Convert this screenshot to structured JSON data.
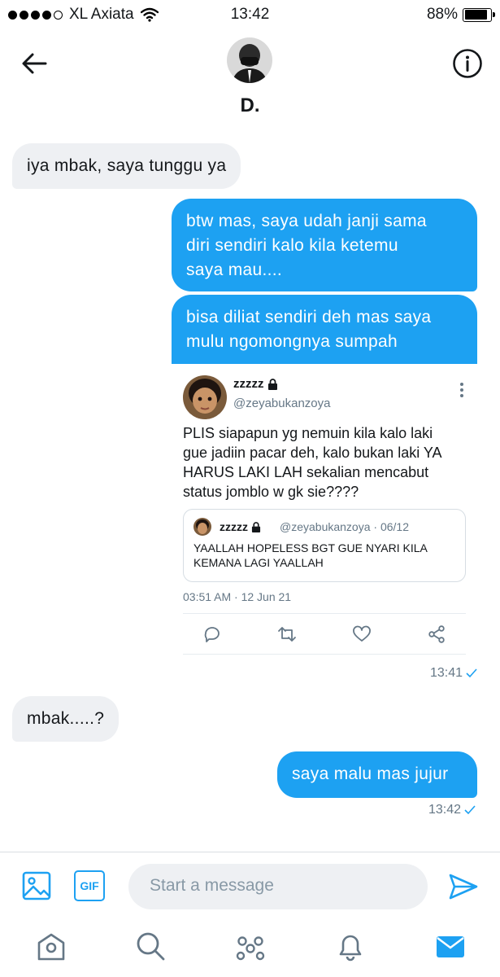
{
  "status_bar": {
    "carrier": "XL Axiata",
    "time": "13:42",
    "battery": "88%",
    "battery_level": 0.88
  },
  "conversation": {
    "name": "D.",
    "back_icon": "arrow-left-icon",
    "info_icon": "info-icon"
  },
  "messages": [
    {
      "direction": "in",
      "text": "iya mbak, saya tunggu ya"
    },
    {
      "direction": "out",
      "lines": [
        "btw mas, saya udah janji sama",
        "diri sendiri kalo kila ketemu",
        "saya mau...."
      ]
    },
    {
      "direction": "out",
      "lines": [
        "bisa diliat sendiri deh mas saya",
        "mulu ngomongnya sumpah"
      ]
    },
    {
      "direction": "in",
      "text": "mbak.....?"
    },
    {
      "direction": "out",
      "text": "saya malu mas jujur"
    }
  ],
  "shared_tweet": {
    "name": "zzzzz",
    "handle": "@zeyabukanzoya",
    "lines": [
      "PLIS siapapun yg nemuin kila kalo laki",
      "gue jadiin pacar deh, kalo bukan laki YA",
      "HARUS LAKI LAH sekalian mencabut",
      "status jomblo w gk sie????"
    ],
    "quoted": {
      "name": "zzzzz",
      "handle_date": "@zeyabukanzoya · 06/12",
      "lines": [
        "YAALLAH HOPELESS BGT GUE NYARI KILA",
        "KEMANA LAGI YAALLAH"
      ]
    },
    "timestamp": "03:51 AM · 12 Jun 21",
    "actions": [
      "reply-icon",
      "retweet-icon",
      "like-icon",
      "share-icon"
    ]
  },
  "timestamps": {
    "first": "13:41",
    "second": "13:42"
  },
  "composer": {
    "placeholder": "Start a message",
    "gif_label": "GIF"
  },
  "tab_bar": [
    "home-icon",
    "search-icon",
    "spaces-icon",
    "notifications-icon",
    "messages-icon"
  ],
  "colors": {
    "accent": "#1da1f2",
    "incoming_bubble": "#eef0f3",
    "muted_text": "#657786"
  }
}
